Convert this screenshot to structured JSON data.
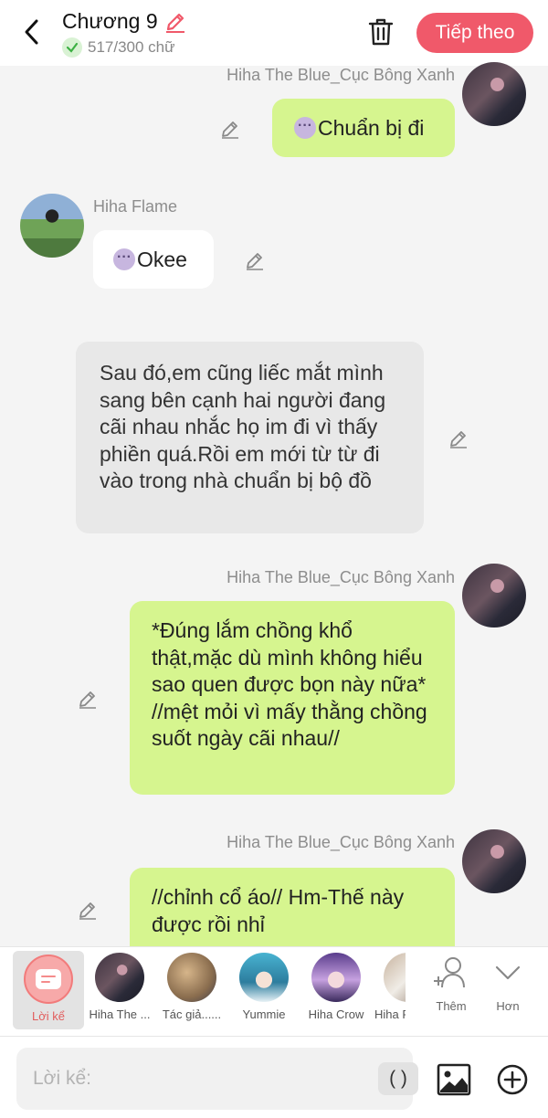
{
  "header": {
    "title": "Chương 9",
    "word_count": "517/300 chữ",
    "next_label": "Tiếp theo"
  },
  "messages": [
    {
      "speaker": "Hiha The Blue_Cục Bông Xanh",
      "text": "Chuẩn bị đi",
      "icon": "speech-bubble-icon"
    },
    {
      "speaker": "Hiha Flame",
      "text": "Okee",
      "icon": "speech-bubble-icon"
    },
    {
      "text": "Sau đó,em cũng liếc mắt mình sang bên cạnh hai người đang cãi nhau nhắc họ im đi vì thấy phiền quá.Rồi em mới từ từ đi vào trong nhà chuẩn bị bộ đồ"
    },
    {
      "speaker": "Hiha The Blue_Cục Bông Xanh",
      "text": "*Đúng lắm chồng khổ thật,mặc dù mình không hiểu sao quen được bọn này nữa* //mệt mỏi vì mấy thằng chồng suốt ngày cãi nhau//"
    },
    {
      "speaker": "Hiha The Blue_Cục Bông Xanh",
      "text": "//chỉnh cổ áo// Hm-Thế này được rồi nhỉ"
    }
  ],
  "characters": [
    {
      "label": "Lời kể"
    },
    {
      "label": "Hiha The ..."
    },
    {
      "label": "Tác giả......"
    },
    {
      "label": "Yummie"
    },
    {
      "label": "Hiha Crow"
    },
    {
      "label": "Hiha F"
    }
  ],
  "tools": {
    "more_label": "Thêm",
    "expand_label": "Hơn"
  },
  "input": {
    "placeholder": "Lời kể:",
    "paren_label": "( )"
  },
  "colors": {
    "accent": "#f0596a",
    "bubble_green": "#d6f58f",
    "bubble_gray": "#e8e8e8"
  }
}
